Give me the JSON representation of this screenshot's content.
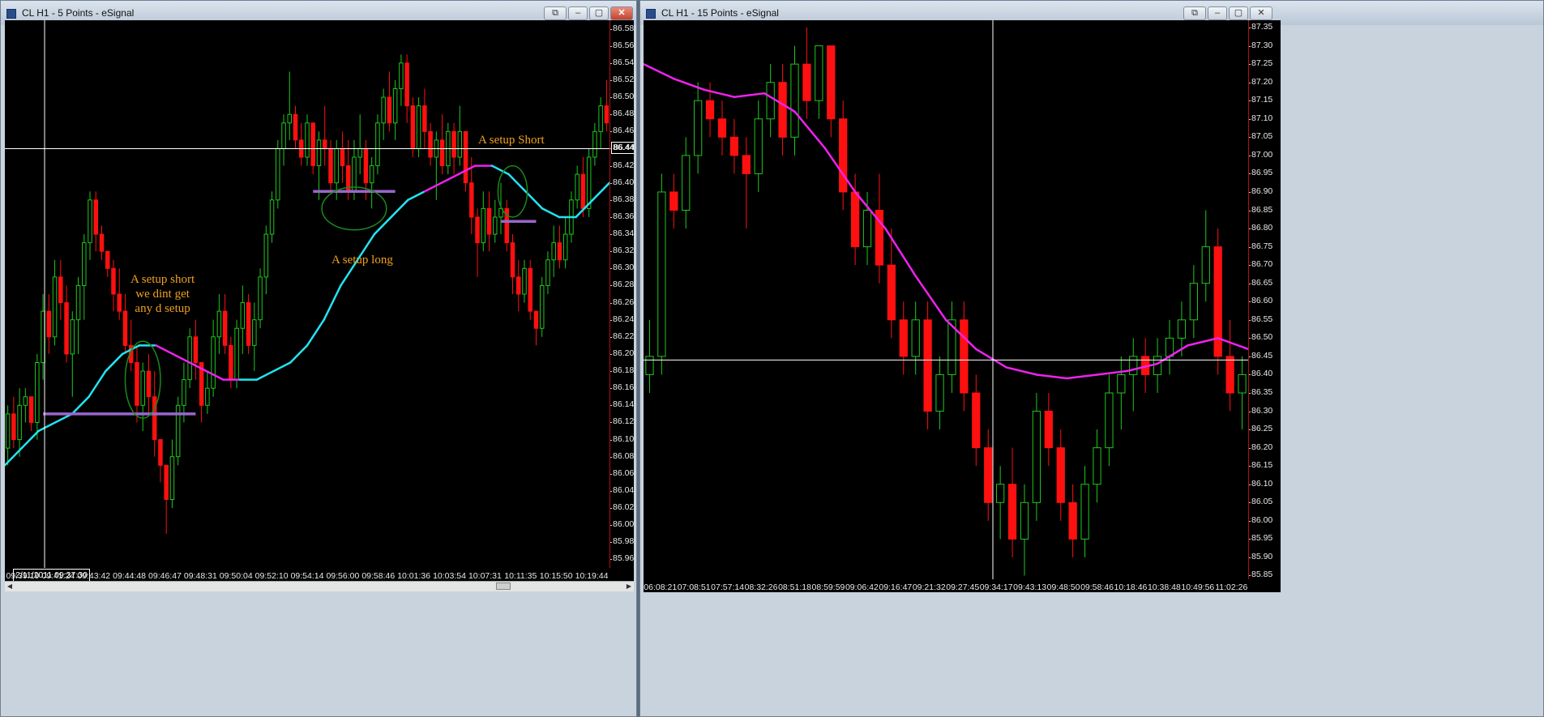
{
  "colors": {
    "up": "#1ec81e",
    "down": "#ff1010",
    "ema_main": "#22e4f2",
    "ema_alt": "#ee22ee",
    "setup_line": "#9966cc",
    "ellipse": "#1a8a1a",
    "annotation": "#f0a020",
    "crosshair": "#ffffff"
  },
  "windows": [
    {
      "title": "CL H1 - 5 Points - eSignal",
      "price_tag": "86.44",
      "date_tag": "2/11/2011 09:37:30",
      "y_ticks": [
        "86.58",
        "86.56",
        "86.54",
        "86.52",
        "86.50",
        "86.48",
        "86.46",
        "86.44",
        "86.42",
        "86.40",
        "86.38",
        "86.36",
        "86.34",
        "86.32",
        "86.30",
        "86.28",
        "86.26",
        "86.24",
        "86.22",
        "86.20",
        "86.18",
        "86.16",
        "86.14",
        "86.12",
        "86.10",
        "86.08",
        "86.06",
        "86.04",
        "86.02",
        "86.00",
        "85.98",
        "85.96"
      ],
      "x_ticks": [
        "09:39:19",
        "09:41:24",
        "09:43:42",
        "09:44:48",
        "09:46:47",
        "09:48:31",
        "09:50:04",
        "09:52:10",
        "09:54:14",
        "09:56:00",
        "09:58:46",
        "10:01:36",
        "10:03:54",
        "10:07:31",
        "10:11:35",
        "10:15:50",
        "10:19:44"
      ],
      "annotations": [
        {
          "id": "setup-short-1",
          "lines": [
            "A setup short",
            "we dint get",
            "any d setup"
          ]
        },
        {
          "id": "setup-long",
          "lines": [
            "A setup long"
          ]
        },
        {
          "id": "setup-short-2",
          "lines": [
            "A setup Short"
          ]
        }
      ]
    },
    {
      "title": "CL H1 - 15 Points - eSignal",
      "y_ticks": [
        "87.35",
        "87.30",
        "87.25",
        "87.20",
        "87.15",
        "87.10",
        "87.05",
        "87.00",
        "86.95",
        "86.90",
        "86.85",
        "86.80",
        "86.75",
        "86.70",
        "86.65",
        "86.60",
        "86.55",
        "86.50",
        "86.45",
        "86.40",
        "86.35",
        "86.30",
        "86.25",
        "86.20",
        "86.15",
        "86.10",
        "86.05",
        "86.00",
        "85.95",
        "85.90",
        "85.85"
      ],
      "x_ticks": [
        "06:08:21",
        "07:08:51",
        "07:57:14",
        "08:32:26",
        "08:51:18",
        "08:59:59",
        "09:06:42",
        "09:16:47",
        "09:21:32",
        "09:27:45",
        "09:34:17",
        "09:43:13",
        "09:48:50",
        "09:58:46",
        "10:18:46",
        "10:38:48",
        "10:49:56",
        "11:02:26"
      ]
    }
  ],
  "chart_data": [
    {
      "type": "candlestick",
      "title": "CL H1 - 5 Points",
      "ylim": [
        85.95,
        86.59
      ],
      "crosshair_price": 86.44,
      "crosshair_time": "09:37:30",
      "candles": [
        [
          86.09,
          86.14,
          86.07,
          86.13
        ],
        [
          86.13,
          86.15,
          86.09,
          86.1
        ],
        [
          86.1,
          86.16,
          86.08,
          86.14
        ],
        [
          86.14,
          86.16,
          86.12,
          86.15
        ],
        [
          86.15,
          86.15,
          86.11,
          86.12
        ],
        [
          86.12,
          86.2,
          86.1,
          86.19
        ],
        [
          86.19,
          86.27,
          86.17,
          86.25
        ],
        [
          86.25,
          86.27,
          86.2,
          86.22
        ],
        [
          86.22,
          86.31,
          86.21,
          86.29
        ],
        [
          86.29,
          86.31,
          86.24,
          86.26
        ],
        [
          86.26,
          86.28,
          86.19,
          86.2
        ],
        [
          86.2,
          86.25,
          86.15,
          86.24
        ],
        [
          86.24,
          86.29,
          86.2,
          86.28
        ],
        [
          86.28,
          86.34,
          86.24,
          86.33
        ],
        [
          86.33,
          86.39,
          86.31,
          86.38
        ],
        [
          86.38,
          86.39,
          86.32,
          86.34
        ],
        [
          86.34,
          86.35,
          86.31,
          86.32
        ],
        [
          86.32,
          86.32,
          86.29,
          86.3
        ],
        [
          86.3,
          86.31,
          86.25,
          86.27
        ],
        [
          86.27,
          86.3,
          86.24,
          86.25
        ],
        [
          86.25,
          86.27,
          86.2,
          86.21
        ],
        [
          86.21,
          86.24,
          86.18,
          86.19
        ],
        [
          86.19,
          86.21,
          86.12,
          86.14
        ],
        [
          86.14,
          86.19,
          86.11,
          86.18
        ],
        [
          86.18,
          86.2,
          86.13,
          86.15
        ],
        [
          86.15,
          86.18,
          86.08,
          86.1
        ],
        [
          86.1,
          86.1,
          86.05,
          86.07
        ],
        [
          86.07,
          86.07,
          85.99,
          86.03
        ],
        [
          86.03,
          86.1,
          86.02,
          86.08
        ],
        [
          86.08,
          86.15,
          86.07,
          86.14
        ],
        [
          86.14,
          86.19,
          86.12,
          86.17
        ],
        [
          86.17,
          86.23,
          86.16,
          86.22
        ],
        [
          86.22,
          86.24,
          86.17,
          86.19
        ],
        [
          86.19,
          86.19,
          86.12,
          86.14
        ],
        [
          86.14,
          86.18,
          86.13,
          86.16
        ],
        [
          86.16,
          86.24,
          86.15,
          86.22
        ],
        [
          86.22,
          86.27,
          86.2,
          86.25
        ],
        [
          86.25,
          86.27,
          86.2,
          86.21
        ],
        [
          86.21,
          86.22,
          86.16,
          86.17
        ],
        [
          86.17,
          86.24,
          86.16,
          86.23
        ],
        [
          86.23,
          86.28,
          86.2,
          86.26
        ],
        [
          86.26,
          86.27,
          86.2,
          86.21
        ],
        [
          86.21,
          86.26,
          86.18,
          86.24
        ],
        [
          86.24,
          86.3,
          86.23,
          86.29
        ],
        [
          86.29,
          86.35,
          86.27,
          86.34
        ],
        [
          86.34,
          86.39,
          86.33,
          86.38
        ],
        [
          86.38,
          86.45,
          86.37,
          86.44
        ],
        [
          86.44,
          86.48,
          86.42,
          86.47
        ],
        [
          86.47,
          86.53,
          86.45,
          86.48
        ],
        [
          86.48,
          86.49,
          86.44,
          86.45
        ],
        [
          86.45,
          86.47,
          86.42,
          86.43
        ],
        [
          86.43,
          86.48,
          86.42,
          86.47
        ],
        [
          86.47,
          86.47,
          86.41,
          86.42
        ],
        [
          86.42,
          86.46,
          86.38,
          86.45
        ],
        [
          86.45,
          86.49,
          86.42,
          86.44
        ],
        [
          86.44,
          86.45,
          86.39,
          86.4
        ],
        [
          86.4,
          86.45,
          86.38,
          86.44
        ],
        [
          86.44,
          86.46,
          86.4,
          86.42
        ],
        [
          86.42,
          86.45,
          86.38,
          86.39
        ],
        [
          86.39,
          86.45,
          86.38,
          86.43
        ],
        [
          86.43,
          86.48,
          86.41,
          86.44
        ],
        [
          86.44,
          86.45,
          86.38,
          86.4
        ],
        [
          86.4,
          86.43,
          86.37,
          86.42
        ],
        [
          86.42,
          86.48,
          86.41,
          86.47
        ],
        [
          86.47,
          86.51,
          86.45,
          86.5
        ],
        [
          86.5,
          86.53,
          86.46,
          86.47
        ],
        [
          86.47,
          86.52,
          86.45,
          86.51
        ],
        [
          86.51,
          86.55,
          86.49,
          86.54
        ],
        [
          86.54,
          86.55,
          86.47,
          86.49
        ],
        [
          86.49,
          86.5,
          86.43,
          86.44
        ],
        [
          86.44,
          86.5,
          86.43,
          86.49
        ],
        [
          86.49,
          86.51,
          86.44,
          86.46
        ],
        [
          86.46,
          86.47,
          86.42,
          86.43
        ],
        [
          86.43,
          86.46,
          86.38,
          86.45
        ],
        [
          86.45,
          86.48,
          86.41,
          86.42
        ],
        [
          86.42,
          86.47,
          86.41,
          86.46
        ],
        [
          86.46,
          86.47,
          86.41,
          86.43
        ],
        [
          86.43,
          86.49,
          86.42,
          86.46
        ],
        [
          86.46,
          86.46,
          86.39,
          86.4
        ],
        [
          86.4,
          86.43,
          86.34,
          86.36
        ],
        [
          86.36,
          86.37,
          86.29,
          86.33
        ],
        [
          86.33,
          86.39,
          86.32,
          86.37
        ],
        [
          86.37,
          86.39,
          86.32,
          86.34
        ],
        [
          86.34,
          86.38,
          86.33,
          86.36
        ],
        [
          86.36,
          86.4,
          86.34,
          86.37
        ],
        [
          86.37,
          86.38,
          86.32,
          86.33
        ],
        [
          86.33,
          86.34,
          86.27,
          86.29
        ],
        [
          86.29,
          86.31,
          86.25,
          86.27
        ],
        [
          86.27,
          86.31,
          86.26,
          86.3
        ],
        [
          86.3,
          86.31,
          86.24,
          86.25
        ],
        [
          86.25,
          86.25,
          86.21,
          86.23
        ],
        [
          86.23,
          86.29,
          86.22,
          86.28
        ],
        [
          86.28,
          86.32,
          86.27,
          86.31
        ],
        [
          86.31,
          86.35,
          86.29,
          86.33
        ],
        [
          86.33,
          86.35,
          86.3,
          86.31
        ],
        [
          86.31,
          86.36,
          86.3,
          86.34
        ],
        [
          86.34,
          86.39,
          86.33,
          86.38
        ],
        [
          86.38,
          86.42,
          86.37,
          86.41
        ],
        [
          86.41,
          86.43,
          86.36,
          86.37
        ],
        [
          86.37,
          86.44,
          86.36,
          86.43
        ],
        [
          86.43,
          86.47,
          86.42,
          86.46
        ],
        [
          86.46,
          86.5,
          86.44,
          86.49
        ],
        [
          86.49,
          86.52,
          86.46,
          86.47
        ]
      ],
      "ema": {
        "start_index": 0,
        "values": [
          86.07,
          86.09,
          86.11,
          86.12,
          86.13,
          86.15,
          86.18,
          86.2,
          86.21,
          86.21,
          86.2,
          86.19,
          86.18,
          86.17,
          86.17,
          86.17,
          86.18,
          86.19,
          86.21,
          86.24,
          86.28,
          86.31,
          86.34,
          86.36,
          86.38,
          86.39,
          86.4,
          86.41,
          86.42,
          86.42,
          86.41,
          86.39,
          86.37,
          86.36,
          86.36,
          86.38,
          86.4
        ],
        "alt_color_segments": [
          [
            9,
            14
          ],
          [
            25,
            29
          ]
        ]
      },
      "setup_levels": [
        {
          "price": 86.13,
          "from": 6,
          "to": 32
        },
        {
          "price": 86.39,
          "from": 52,
          "to": 66
        },
        {
          "price": 86.355,
          "from": 84,
          "to": 90
        }
      ],
      "ellipses": [
        {
          "center_index": 23,
          "price": 86.17,
          "width_bars": 6,
          "height_price": 0.09
        },
        {
          "center_index": 59,
          "price": 86.37,
          "width_bars": 11,
          "height_price": 0.05
        },
        {
          "center_index": 86,
          "price": 86.39,
          "width_bars": 5,
          "height_price": 0.06
        }
      ]
    },
    {
      "type": "candlestick",
      "title": "CL H1 - 15 Points",
      "ylim": [
        85.84,
        87.37
      ],
      "crosshair_price": 86.44,
      "crosshair_time": "09:34:17",
      "candles": [
        [
          86.4,
          86.55,
          86.35,
          86.45
        ],
        [
          86.45,
          86.95,
          86.4,
          86.9
        ],
        [
          86.9,
          86.95,
          86.8,
          86.85
        ],
        [
          86.85,
          87.05,
          86.8,
          87.0
        ],
        [
          87.0,
          87.2,
          86.95,
          87.15
        ],
        [
          87.15,
          87.2,
          87.05,
          87.1
        ],
        [
          87.1,
          87.15,
          87.0,
          87.05
        ],
        [
          87.05,
          87.1,
          86.95,
          87.0
        ],
        [
          87.0,
          87.05,
          86.8,
          86.95
        ],
        [
          86.95,
          87.15,
          86.9,
          87.1
        ],
        [
          87.1,
          87.25,
          87.05,
          87.2
        ],
        [
          87.2,
          87.25,
          87.0,
          87.05
        ],
        [
          87.05,
          87.3,
          87.0,
          87.25
        ],
        [
          87.25,
          87.35,
          87.1,
          87.15
        ],
        [
          87.15,
          87.3,
          87.1,
          87.3
        ],
        [
          87.3,
          87.3,
          87.05,
          87.1
        ],
        [
          87.1,
          87.15,
          86.85,
          86.9
        ],
        [
          86.9,
          86.95,
          86.7,
          86.75
        ],
        [
          86.75,
          86.9,
          86.7,
          86.85
        ],
        [
          86.85,
          86.95,
          86.65,
          86.7
        ],
        [
          86.7,
          86.8,
          86.5,
          86.55
        ],
        [
          86.55,
          86.6,
          86.4,
          86.45
        ],
        [
          86.45,
          86.6,
          86.4,
          86.55
        ],
        [
          86.55,
          86.6,
          86.25,
          86.3
        ],
        [
          86.3,
          86.45,
          86.25,
          86.4
        ],
        [
          86.4,
          86.6,
          86.35,
          86.55
        ],
        [
          86.55,
          86.6,
          86.3,
          86.35
        ],
        [
          86.35,
          86.4,
          86.15,
          86.2
        ],
        [
          86.2,
          86.25,
          86.0,
          86.05
        ],
        [
          86.05,
          86.15,
          85.95,
          86.1
        ],
        [
          86.1,
          86.2,
          85.9,
          85.95
        ],
        [
          85.95,
          86.1,
          85.85,
          86.05
        ],
        [
          86.05,
          86.35,
          86.0,
          86.3
        ],
        [
          86.3,
          86.35,
          86.15,
          86.2
        ],
        [
          86.2,
          86.25,
          86.0,
          86.05
        ],
        [
          86.05,
          86.1,
          85.9,
          85.95
        ],
        [
          85.95,
          86.15,
          85.9,
          86.1
        ],
        [
          86.1,
          86.25,
          86.05,
          86.2
        ],
        [
          86.2,
          86.4,
          86.15,
          86.35
        ],
        [
          86.35,
          86.45,
          86.25,
          86.4
        ],
        [
          86.4,
          86.5,
          86.3,
          86.45
        ],
        [
          86.45,
          86.5,
          86.35,
          86.4
        ],
        [
          86.4,
          86.5,
          86.35,
          86.45
        ],
        [
          86.45,
          86.55,
          86.4,
          86.5
        ],
        [
          86.5,
          86.6,
          86.45,
          86.55
        ],
        [
          86.55,
          86.7,
          86.5,
          86.65
        ],
        [
          86.65,
          86.85,
          86.6,
          86.75
        ],
        [
          86.75,
          86.8,
          86.4,
          86.45
        ],
        [
          86.45,
          86.55,
          86.3,
          86.35
        ],
        [
          86.35,
          86.45,
          86.25,
          86.4
        ]
      ],
      "ema": {
        "start_index": 0,
        "values": [
          87.25,
          87.21,
          87.18,
          87.16,
          87.17,
          87.12,
          87.02,
          86.9,
          86.8,
          86.67,
          86.55,
          86.47,
          86.42,
          86.4,
          86.39,
          86.4,
          86.41,
          86.43,
          86.48,
          86.5,
          86.47
        ],
        "alt_color_segments": [
          [
            0,
            16
          ],
          [
            16,
            20
          ]
        ]
      }
    }
  ]
}
